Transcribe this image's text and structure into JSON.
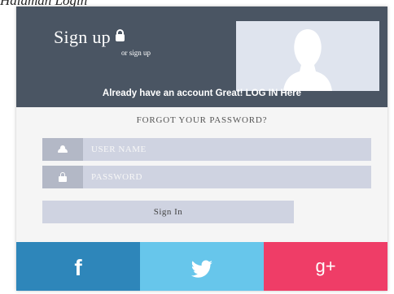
{
  "caption": "Halaman Login",
  "header": {
    "title": "Sign up",
    "subtitle": "or sign up",
    "login_link": "Already have an account Great! LOG IN Here",
    "lock_icon": "lock-icon",
    "avatar_icon": "user-silhouette"
  },
  "form": {
    "forgot_password": "FORGOT YOUR PASSWORD?",
    "username": {
      "placeholder": "USER NAME",
      "value": "",
      "icon": "user-icon"
    },
    "password": {
      "placeholder": "PASSWORD",
      "value": "",
      "icon": "lock-icon"
    },
    "signin_label": "Sign In"
  },
  "social": [
    {
      "name": "facebook",
      "glyph": "f",
      "color": "#2e86ba"
    },
    {
      "name": "twitter",
      "glyph": "twitter-bird",
      "color": "#67c6eb"
    },
    {
      "name": "google-plus",
      "glyph": "g+",
      "color": "#ef3d67"
    }
  ],
  "colors": {
    "header_bg": "#4a5563",
    "field_bg": "#cfd3e1",
    "icon_box_bg": "#b3b8c6",
    "avatar_bg": "#dfe4ee"
  }
}
